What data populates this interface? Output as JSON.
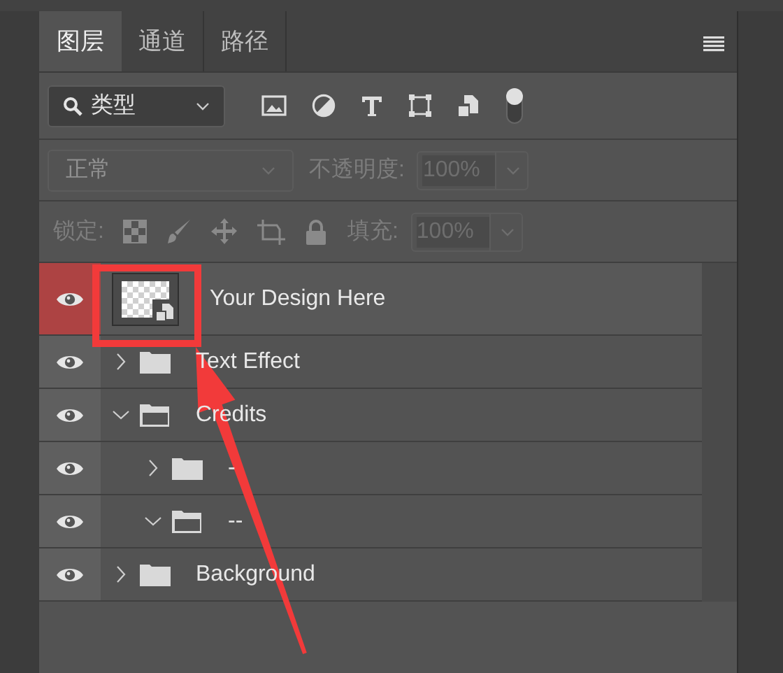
{
  "tabs": [
    {
      "label": "图层",
      "selected": true
    },
    {
      "label": "通道",
      "selected": false
    },
    {
      "label": "路径",
      "selected": false
    }
  ],
  "filter": {
    "value": "类型",
    "on": true
  },
  "blend": {
    "value": "正常",
    "disabled": true,
    "opacity_label": "不透明度:",
    "opacity": "100%"
  },
  "lock": {
    "label": "锁定:",
    "fill_label": "填充:",
    "fill": "100%"
  },
  "layers": [
    {
      "name": "Your Design Here",
      "kind": "smart_object",
      "visible": true,
      "selected": true
    },
    {
      "name": "Text Effect",
      "kind": "group",
      "visible": true,
      "selected": false,
      "expanded": false
    },
    {
      "name": "Credits",
      "kind": "group",
      "visible": true,
      "selected": false,
      "expanded": true,
      "children": [
        {
          "name": "-",
          "kind": "group",
          "visible": true,
          "selected": false,
          "expanded": false
        },
        {
          "name": "--",
          "kind": "group",
          "visible": true,
          "selected": false,
          "expanded": true
        }
      ]
    },
    {
      "name": "Background",
      "kind": "group",
      "visible": true,
      "selected": false,
      "expanded": false
    }
  ],
  "annotation": {
    "kind": "highlight_arrow"
  }
}
